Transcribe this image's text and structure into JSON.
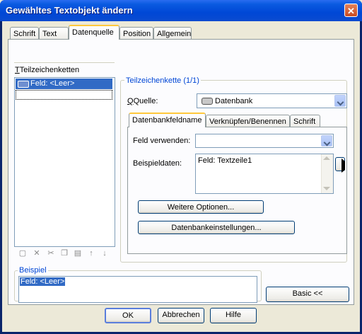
{
  "window": {
    "title": "Gewähltes Textobjekt ändern",
    "close_glyph": "✕"
  },
  "tabs": [
    {
      "label": "Schrift"
    },
    {
      "label": "Text"
    },
    {
      "label": "Datenquelle"
    },
    {
      "label": "Position"
    },
    {
      "label": "Allgemein"
    }
  ],
  "left": {
    "list_title": "Teilzeichenketten",
    "list_items": [
      {
        "label": "Feld: <Leer>"
      }
    ],
    "toolbar_icons": [
      "add-icon",
      "delete-icon",
      "cut-icon",
      "copy-icon",
      "paste-icon",
      "move-up-icon",
      "move-down-icon"
    ]
  },
  "right": {
    "group_title": "Teilzeichenkette (1/1)",
    "source_label": "Quelle:",
    "source_value": "Datenbank",
    "subtabs": [
      {
        "label": "Datenbankfeldname"
      },
      {
        "label": "Verknüpfen/Benennen"
      },
      {
        "label": "Schrift"
      }
    ],
    "field_label": "Feld verwenden:",
    "field_value": "",
    "sample_label": "Beispieldaten:",
    "sample_value": "Feld: Textzeile1",
    "more_options": "Weitere Optionen...",
    "db_settings": "Datenbankeinstellungen..."
  },
  "example": {
    "title": "Beispiel",
    "value": "Feld: <Leer>"
  },
  "basic_button": "Basic <<",
  "footer": {
    "ok": "OK",
    "cancel": "Abbrechen",
    "help": "Hilfe"
  },
  "colors": {
    "accent": "#316ac5",
    "title_blue": "#0046d5",
    "tab_highlight": "#ffc83c"
  }
}
